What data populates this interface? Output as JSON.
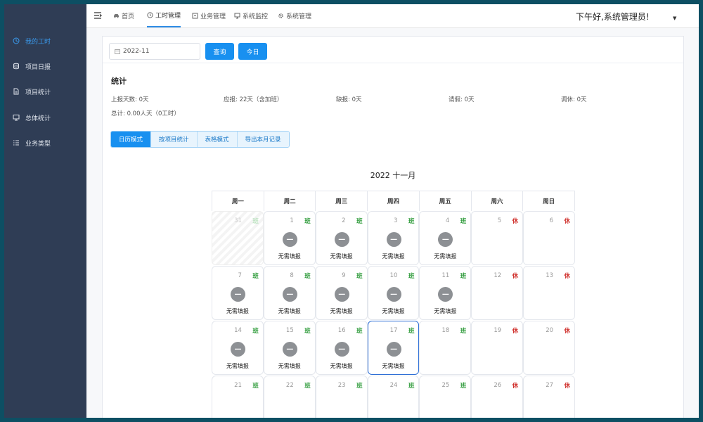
{
  "sidebar": {
    "items": [
      {
        "label": "我的工时",
        "icon": "clock-icon",
        "active": true
      },
      {
        "label": "项目日报",
        "icon": "database-icon",
        "active": false
      },
      {
        "label": "项目统计",
        "icon": "file-icon",
        "active": false
      },
      {
        "label": "总体统计",
        "icon": "monitor-icon",
        "active": false
      },
      {
        "label": "业务类型",
        "icon": "list-icon",
        "active": false
      }
    ]
  },
  "topnav": {
    "tabs": [
      {
        "label": "首页",
        "icon": "car-icon"
      },
      {
        "label": "工时管理",
        "icon": "clock-icon",
        "active": true
      },
      {
        "label": "业务管理",
        "icon": "box-icon"
      },
      {
        "label": "系统监控",
        "icon": "monitor-icon"
      },
      {
        "label": "系统管理",
        "icon": "gear-icon"
      }
    ],
    "greeting": "下午好,系统管理员!",
    "caret": "▼"
  },
  "toolbar": {
    "month_value": "2022-11",
    "query_label": "查询",
    "today_label": "今日"
  },
  "stats": {
    "title": "统计",
    "reported": "上报天数: 0天",
    "required": "应报: 22天（含加班）",
    "missing": "缺报: 0天",
    "leave": "请假: 0天",
    "compensatory": "调休: 0天",
    "total": "总计: 0.00人天（0工时）"
  },
  "modes": [
    "日历模式",
    "按项目统计",
    "表格模式",
    "导出本月记录"
  ],
  "calendar": {
    "title": "2022 十一月",
    "weekdays": [
      "周一",
      "周二",
      "周三",
      "周四",
      "周五",
      "周六",
      "周日"
    ],
    "status_text": "无需填报",
    "status_symbol": "—",
    "colors": {
      "work": "#2e9b3a",
      "rest": "#d0312d",
      "accent": "#1890f0"
    },
    "weeks": [
      [
        {
          "day": "31",
          "tag": "班",
          "kind": "work",
          "prev": true
        },
        {
          "day": "1",
          "tag": "班",
          "kind": "work",
          "status": true
        },
        {
          "day": "2",
          "tag": "班",
          "kind": "work",
          "status": true
        },
        {
          "day": "3",
          "tag": "班",
          "kind": "work",
          "status": true
        },
        {
          "day": "4",
          "tag": "班",
          "kind": "work",
          "status": true
        },
        {
          "day": "5",
          "tag": "休",
          "kind": "rest"
        },
        {
          "day": "6",
          "tag": "休",
          "kind": "rest"
        }
      ],
      [
        {
          "day": "7",
          "tag": "班",
          "kind": "work",
          "status": true
        },
        {
          "day": "8",
          "tag": "班",
          "kind": "work",
          "status": true
        },
        {
          "day": "9",
          "tag": "班",
          "kind": "work",
          "status": true
        },
        {
          "day": "10",
          "tag": "班",
          "kind": "work",
          "status": true
        },
        {
          "day": "11",
          "tag": "班",
          "kind": "work",
          "status": true
        },
        {
          "day": "12",
          "tag": "休",
          "kind": "rest"
        },
        {
          "day": "13",
          "tag": "休",
          "kind": "rest"
        }
      ],
      [
        {
          "day": "14",
          "tag": "班",
          "kind": "work",
          "status": true
        },
        {
          "day": "15",
          "tag": "班",
          "kind": "work",
          "status": true
        },
        {
          "day": "16",
          "tag": "班",
          "kind": "work",
          "status": true
        },
        {
          "day": "17",
          "tag": "班",
          "kind": "work",
          "status": true,
          "today": true
        },
        {
          "day": "18",
          "tag": "班",
          "kind": "work"
        },
        {
          "day": "19",
          "tag": "休",
          "kind": "rest"
        },
        {
          "day": "20",
          "tag": "休",
          "kind": "rest"
        }
      ],
      [
        {
          "day": "21",
          "tag": "班",
          "kind": "work"
        },
        {
          "day": "22",
          "tag": "班",
          "kind": "work"
        },
        {
          "day": "23",
          "tag": "班",
          "kind": "work"
        },
        {
          "day": "24",
          "tag": "班",
          "kind": "work"
        },
        {
          "day": "25",
          "tag": "班",
          "kind": "work"
        },
        {
          "day": "26",
          "tag": "休",
          "kind": "rest"
        },
        {
          "day": "27",
          "tag": "休",
          "kind": "rest"
        }
      ]
    ]
  }
}
